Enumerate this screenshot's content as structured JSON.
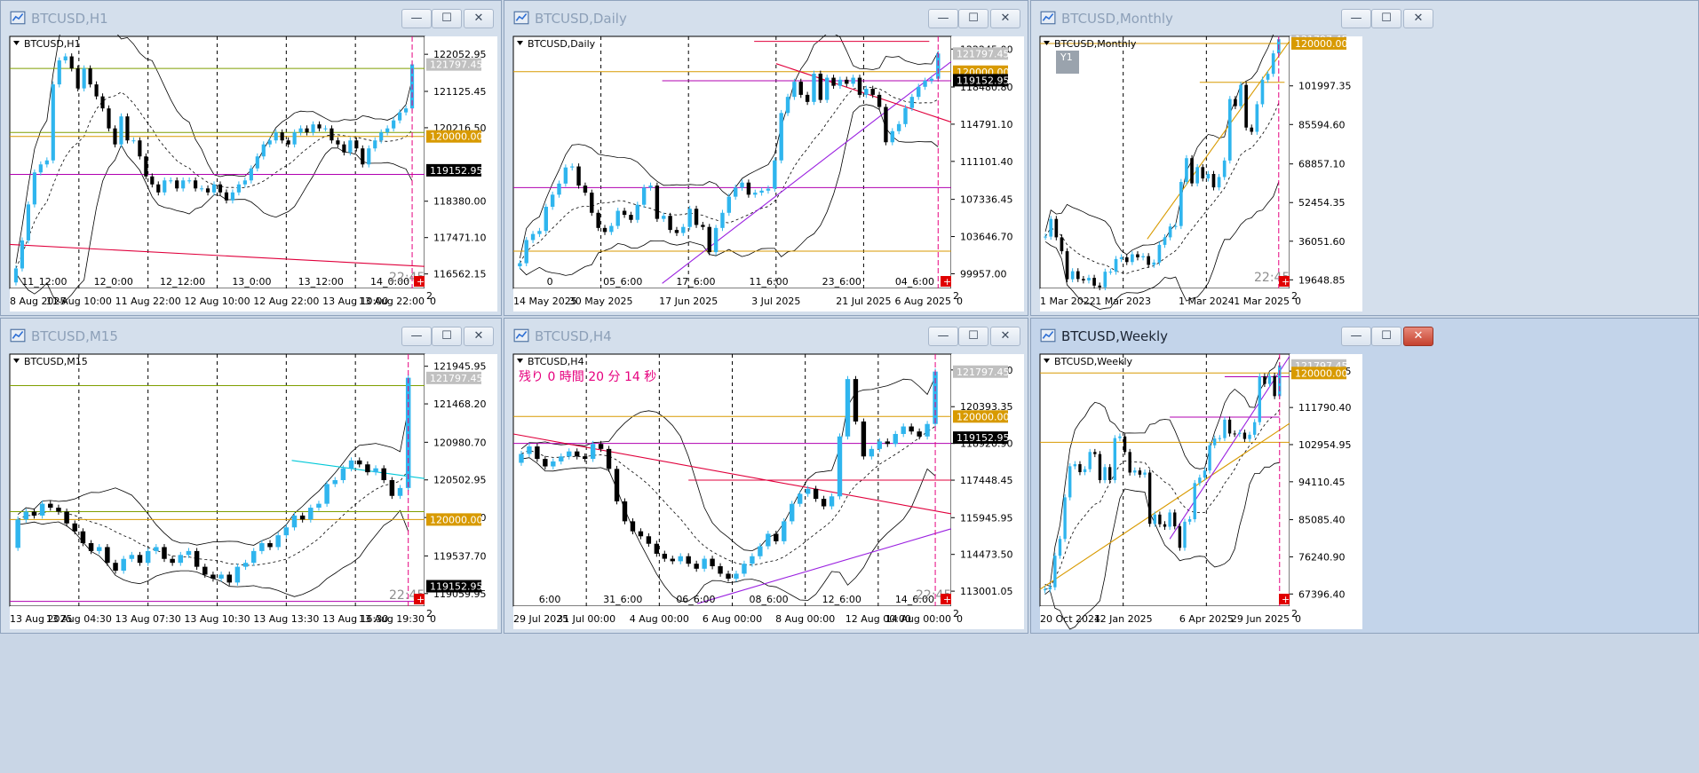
{
  "colors": {
    "up": "#2fb5ee",
    "down": "#000000",
    "band": "#000000",
    "level_orange": "#d89a00",
    "level_magenta": "#b000b0",
    "level_red": "#e0003c",
    "level_green": "#7f9f00",
    "trend_purple": "#9a20e0",
    "trend_orange": "#f39a2e",
    "trend_red": "#e6244a",
    "cursor": "#e6007e",
    "price_gray": "#c0c0c0",
    "price_orange": "#d89a00",
    "price_black": "#000000",
    "countdown": "#e6007e"
  },
  "windows": [
    {
      "title": "BTCUSD,H1",
      "label": "BTCUSD,H1",
      "active": false
    },
    {
      "title": "BTCUSD,Daily",
      "label": "BTCUSD,Daily",
      "active": false
    },
    {
      "title": "BTCUSD,Monthly",
      "label": "BTCUSD,Monthly",
      "active": false
    },
    {
      "title": "BTCUSD,M15",
      "label": "BTCUSD,M15",
      "active": false
    },
    {
      "title": "BTCUSD,H4",
      "label": "BTCUSD,H4",
      "active": false
    },
    {
      "title": "BTCUSD,Weekly",
      "label": "BTCUSD,Weekly",
      "active": true
    }
  ],
  "window_controls": {
    "minimize": "—",
    "maximize": "☐",
    "close": "✕"
  },
  "chart_data": [
    {
      "type": "candlestick",
      "symbol": "BTCUSD",
      "timeframe": "H1",
      "ylim": [
        116200,
        122500
      ],
      "y_ticks": [
        122052.95,
        121125.45,
        120216.5,
        118380.0,
        117471.1,
        116562.15
      ],
      "price_tags": [
        {
          "value": 121797.45,
          "style": "gray",
          "label": "121797.45"
        },
        {
          "value": 120000.0,
          "style": "orange",
          "label": "120000.00"
        },
        {
          "value": 119152.95,
          "style": "black",
          "label": "119152.95"
        }
      ],
      "hlines": [
        {
          "value": 121700,
          "color": "green"
        },
        {
          "value": 120100,
          "color": "green"
        },
        {
          "value": 120000,
          "color": "orange"
        },
        {
          "value": 119050,
          "color": "magenta"
        }
      ],
      "trendlines": [
        {
          "color": "red",
          "from": [
            0,
            117300
          ],
          "to": [
            1,
            116750
          ]
        }
      ],
      "top_labels": [
        "11_12:00",
        "12_0:00",
        "12_12:00",
        "13_0:00",
        "13_12:00",
        "14_0:00"
      ],
      "bottom_labels": [
        "8 Aug 2025",
        "11 Aug 10:00",
        "11 Aug 22:00",
        "12 Aug 10:00",
        "12 Aug 22:00",
        "13 Aug 10:00",
        "13 Aug 22:00"
      ],
      "countdown": "22:45",
      "countdown_style": "gray",
      "scale_label": "2\n0",
      "candles": [
        116700,
        117400,
        118300,
        119100,
        119300,
        119400,
        121300,
        121900,
        122000,
        121700,
        121200,
        121700,
        121300,
        121000,
        120700,
        120200,
        119800,
        120500,
        119900,
        119900,
        119500,
        119000,
        118800,
        118600,
        118900,
        118900,
        118700,
        118900,
        118900,
        118700,
        118700,
        118600,
        118800,
        118600,
        118400,
        118600,
        118800,
        118900,
        119200,
        119500,
        119800,
        119900,
        120100,
        119900,
        119800,
        120100,
        120200,
        120100,
        120300,
        120200,
        120200,
        119900,
        119800,
        119600,
        119900,
        119700,
        119300,
        119700,
        119900,
        120100,
        120200,
        120400,
        120600,
        120700,
        121800
      ]
    },
    {
      "type": "candlestick",
      "symbol": "BTCUSD",
      "timeframe": "Daily",
      "ylim": [
        98500,
        123500
      ],
      "y_ticks": [
        122245.0,
        118480.8,
        114791.1,
        111101.4,
        107336.45,
        103646.7,
        99957.0
      ],
      "price_tags": [
        {
          "value": 121797.45,
          "style": "gray",
          "label": "121797.45"
        },
        {
          "value": 120000.0,
          "style": "orange",
          "label": "120000.00"
        },
        {
          "value": 119152.95,
          "style": "black",
          "label": "119152.95"
        }
      ],
      "hlines": [
        {
          "value": 123000,
          "color": "red",
          "from": 0.55,
          "to": 0.95
        },
        {
          "value": 120000,
          "color": "orange"
        },
        {
          "value": 119100,
          "color": "magenta",
          "from": 0.34
        },
        {
          "value": 108500,
          "color": "magenta"
        },
        {
          "value": 102200,
          "color": "orange"
        }
      ],
      "trendlines": [
        {
          "color": "purple",
          "from": [
            0.34,
            99000
          ],
          "to": [
            1,
            121000
          ]
        },
        {
          "color": "red",
          "from": [
            0.6,
            120800
          ],
          "to": [
            1,
            115000
          ]
        }
      ],
      "top_labels": [
        "0",
        "05_6:00",
        "17_6:00",
        "11_6:00",
        "23_6:00",
        "04_6:00"
      ],
      "bottom_labels": [
        "14 May 2025",
        "30 May 2025",
        "17 Jun 2025",
        "3 Jul 2025",
        "21 Jul 2025",
        "6 Aug 2025"
      ],
      "countdown": "",
      "scale_label": "2\n0",
      "candles": [
        101000,
        103300,
        103900,
        104200,
        106600,
        107800,
        108900,
        110500,
        110600,
        108700,
        108000,
        106000,
        104500,
        104100,
        104700,
        106200,
        105800,
        105300,
        106800,
        108500,
        108700,
        105400,
        105700,
        104300,
        104000,
        104600,
        106400,
        104800,
        104600,
        102100,
        104500,
        106000,
        107600,
        108500,
        109000,
        107800,
        108000,
        108200,
        108400,
        111200,
        115900,
        117500,
        119000,
        117700,
        117000,
        119800,
        117200,
        119400,
        118600,
        119200,
        118800,
        119400,
        117700,
        118300,
        117700,
        116500,
        113000,
        114100,
        114800,
        116400,
        117500,
        118500,
        119100,
        119300,
        121800
      ]
    },
    {
      "type": "candlestick",
      "symbol": "BTCUSD",
      "timeframe": "Monthly",
      "ylim": [
        16000,
        123000
      ],
      "y_ticks": [
        101997.35,
        85594.6,
        68857.1,
        52454.35,
        36051.6,
        19648.85
      ],
      "price_tags": [
        {
          "value": 121797.45,
          "style": "gray",
          "label": "121797.45"
        },
        {
          "value": 120000.0,
          "style": "orange",
          "label": "120000.00"
        }
      ],
      "hlines": [
        {
          "value": 120000,
          "color": "orange"
        },
        {
          "value": 103500,
          "color": "orange",
          "from": 0.64,
          "to": 0.98
        }
      ],
      "trendlines": [
        {
          "color": "orange",
          "from": [
            0.43,
            37000
          ],
          "to": [
            1,
            121000
          ]
        }
      ],
      "top_labels": [],
      "bottom_labels": [
        "1 Mar 2022",
        "1 Mar 2023",
        "1 Mar 2024",
        "1 Mar 2025"
      ],
      "countdown": "22:45",
      "countdown_style": "gray",
      "scale_label": "2\n0",
      "badge": "Y1",
      "candles": [
        38000,
        45500,
        37700,
        31800,
        19900,
        23300,
        20000,
        19400,
        20500,
        17200,
        16500,
        23100,
        23100,
        28500,
        29200,
        27200,
        30500,
        29200,
        29700,
        26000,
        27000,
        34500,
        37700,
        42300,
        42500,
        61200,
        71300,
        60600,
        67500,
        62700,
        64600,
        58900,
        63300,
        70300,
        96400,
        93400,
        102400,
        84300,
        82500,
        94200,
        104600,
        107100,
        115800,
        121800
      ]
    },
    {
      "type": "candlestick",
      "symbol": "BTCUSD",
      "timeframe": "M15",
      "ylim": [
        118900,
        122100
      ],
      "y_ticks": [
        121945.95,
        121468.2,
        120980.7,
        120502.95,
        120025.2,
        119537.7,
        119059.95
      ],
      "price_tags": [
        {
          "value": 121797.45,
          "style": "gray",
          "label": "121797.45"
        },
        {
          "value": 120000.0,
          "style": "orange",
          "label": "120000.00"
        },
        {
          "value": 119152.95,
          "style": "black",
          "label": "119152.95"
        }
      ],
      "hlines": [
        {
          "value": 121700,
          "color": "green"
        },
        {
          "value": 120100,
          "color": "green"
        },
        {
          "value": 120000,
          "color": "orange"
        },
        {
          "value": 118960,
          "color": "magenta"
        }
      ],
      "trendlines": [
        {
          "color": "cyan",
          "from": [
            0.68,
            120750
          ],
          "to": [
            1,
            120520
          ]
        }
      ],
      "top_labels": [],
      "bottom_labels": [
        "13 Aug 2025",
        "13 Aug 04:30",
        "13 Aug 07:30",
        "13 Aug 10:30",
        "13 Aug 13:30",
        "13 Aug 16:30",
        "13 Aug 19:30"
      ],
      "countdown": "22:45",
      "countdown_style": "gray",
      "scale_label": "2\n0",
      "candles": [
        120000,
        120100,
        120050,
        120200,
        120150,
        120100,
        119950,
        119850,
        119700,
        119600,
        119650,
        119450,
        119350,
        119500,
        119550,
        119450,
        119600,
        119650,
        119500,
        119450,
        119550,
        119600,
        119400,
        119300,
        119250,
        119300,
        119200,
        119400,
        119450,
        119600,
        119700,
        119650,
        119800,
        119900,
        120050,
        120000,
        120150,
        120200,
        120450,
        120500,
        120650,
        120750,
        120700,
        120600,
        120650,
        120500,
        120300,
        120400,
        121800
      ]
    },
    {
      "type": "candlestick",
      "symbol": "BTCUSD",
      "timeframe": "H4",
      "ylim": [
        112400,
        122500
      ],
      "y_ticks": [
        121865.6,
        120393.35,
        118920.9,
        117448.45,
        115945.95,
        114473.5,
        113001.05
      ],
      "price_tags": [
        {
          "value": 121797.45,
          "style": "gray",
          "label": "121797.45"
        },
        {
          "value": 120000.0,
          "style": "orange",
          "label": "120000.00"
        },
        {
          "value": 119152.95,
          "style": "black",
          "label": "119152.95"
        }
      ],
      "hlines": [
        {
          "value": 120000,
          "color": "orange"
        },
        {
          "value": 118920,
          "color": "magenta"
        },
        {
          "value": 117450,
          "color": "red",
          "from": 0.4
        }
      ],
      "trendlines": [
        {
          "color": "red",
          "from": [
            0,
            119300
          ],
          "to": [
            1,
            116100
          ]
        },
        {
          "color": "purple",
          "from": [
            0.42,
            112500
          ],
          "to": [
            1,
            115500
          ]
        }
      ],
      "top_labels": [
        "6:00",
        "31_6:00",
        "06_6:00",
        "08_6:00",
        "12_6:00",
        "14_6:00"
      ],
      "bottom_labels": [
        "29 Jul 2025",
        "31 Jul 00:00",
        "4 Aug 00:00",
        "6 Aug 00:00",
        "8 Aug 00:00",
        "12 Aug 00:00",
        "14 Aug 00:00"
      ],
      "countdown": "22:45",
      "countdown_style": "gray",
      "scale_label": "2\n0",
      "overlay_text": "残り 0 時間 20 分 14 秒",
      "candles": [
        118500,
        118800,
        118300,
        118000,
        118200,
        118400,
        118600,
        118400,
        118300,
        118900,
        118700,
        117900,
        116600,
        115800,
        115400,
        115200,
        114900,
        114500,
        114300,
        114200,
        114400,
        114100,
        113900,
        114300,
        114000,
        113700,
        113500,
        113700,
        114100,
        114400,
        114800,
        115300,
        115000,
        115800,
        116500,
        116900,
        117100,
        116700,
        116400,
        116800,
        119200,
        121500,
        119800,
        118400,
        118700,
        119000,
        118900,
        119300,
        119600,
        119400,
        119200,
        119700,
        121800
      ]
    },
    {
      "type": "candlestick",
      "symbol": "BTCUSD",
      "timeframe": "Weekly",
      "ylim": [
        64500,
        124500
      ],
      "y_ticks": [
        120455.35,
        111790.4,
        102954.95,
        94110.45,
        85085.4,
        76240.9,
        67396.4
      ],
      "price_tags": [
        {
          "value": 121797.45,
          "style": "gray",
          "label": "121797.45"
        },
        {
          "value": 120000.0,
          "style": "orange",
          "label": "120000.00"
        }
      ],
      "hlines": [
        {
          "value": 120000,
          "color": "orange"
        },
        {
          "value": 119100,
          "color": "magenta",
          "from": 0.74
        },
        {
          "value": 109500,
          "color": "magenta",
          "from": 0.52,
          "to": 0.96
        },
        {
          "value": 103500,
          "color": "orange"
        }
      ],
      "trendlines": [
        {
          "color": "orange",
          "from": [
            0,
            68500
          ],
          "to": [
            1,
            108000
          ]
        },
        {
          "color": "purple",
          "from": [
            0.52,
            80500
          ],
          "to": [
            1,
            124000
          ]
        }
      ],
      "top_labels": [],
      "bottom_labels": [
        "20 Oct 2024",
        "12 Jan 2025",
        "6 Apr 2025",
        "29 Jun 2025"
      ],
      "countdown": "",
      "scale_label": "2\n0",
      "candles": [
        68500,
        69000,
        76500,
        80500,
        90400,
        97800,
        98300,
        96400,
        97100,
        101200,
        100700,
        94500,
        97600,
        94500,
        104500,
        104900,
        101200,
        96300,
        96800,
        95800,
        96300,
        84100,
        86300,
        84000,
        83400,
        86800,
        83500,
        78400,
        84600,
        85200,
        93800,
        95100,
        96800,
        102800,
        104400,
        104500,
        108900,
        105600,
        105500,
        105800,
        104300,
        105300,
        108300,
        119200,
        117400,
        119300,
        114500,
        121800
      ]
    }
  ]
}
